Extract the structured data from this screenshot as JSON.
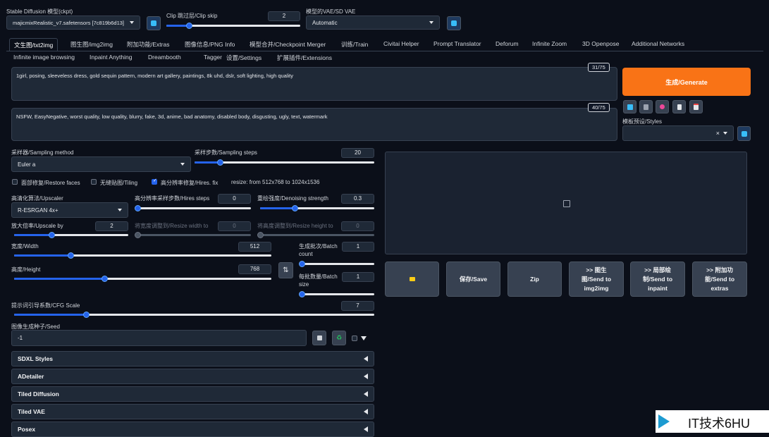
{
  "top": {
    "checkpoint_label": "Stable Diffusion 模型(ckpt)",
    "checkpoint_value": "majicmixRealistic_v7.safetensors [7c819b6d13]",
    "clip_label": "Clip 跳过层/Clip skip",
    "clip_value": "2",
    "clip_fraction": 0.17,
    "vae_label": "模型的VAE/SD VAE",
    "vae_value": "Automatic"
  },
  "tabs_row1": [
    "文生图/txt2img",
    "图生图/img2img",
    "附加功能/Extras",
    "图像信息/PNG Info",
    "模型合并/Checkpoint Merger",
    "训练/Train",
    "Civitai Helper",
    "Prompt Translator",
    "Deforum",
    "Infinite Zoom",
    "3D Openpose",
    "Additional Networks"
  ],
  "tabs_row2": [
    "Infinite image browsing",
    "Inpaint Anything",
    "Dreambooth",
    "Tagger",
    "设置/Settings",
    "扩展插件/Extensions"
  ],
  "prompt": {
    "positive": "1girl, posing, sleeveless dress, gold sequin pattern, modern art gallery, paintings, 8k uhd, dslr, soft lighting, high quality",
    "positive_count": "31/75",
    "negative": "NSFW, EasyNegative, worst quality, low quality, blurry, fake, 3d, anime, bad anatomy, disabled body, disgusting, ugly, text, watermark",
    "negative_count": "40/75"
  },
  "generate_label": "生成/Generate",
  "styles_label": "模板预设/Styles",
  "sampling": {
    "method_label": "采样器/Sampling method",
    "method_value": "Euler a",
    "steps_label": "采样步数/Sampling steps",
    "steps_value": "20",
    "steps_fraction": 0.14
  },
  "checks": {
    "restore_faces": "面部修复/Restore faces",
    "tiling": "无缝贴图/Tiling",
    "hires_fix": "高分辨率修复/Hires. fix",
    "resize_info": "resize: from 512x768 to 1024x1536"
  },
  "hires": {
    "upscaler_label": "高清化算法/Upscaler",
    "upscaler_value": "R-ESRGAN 4x+",
    "steps_label": "高分辨率采样步数/Hires steps",
    "steps_value": "0",
    "steps_fraction": 0.0,
    "denoise_label": "重绘强度/Denoising strength",
    "denoise_value": "0.3",
    "denoise_fraction": 0.3,
    "upscale_label": "放大倍率/Upscale by",
    "upscale_value": "2",
    "upscale_fraction": 0.33,
    "resize_w_label": "将宽度调整到/Resize width to",
    "resize_w_value": "0",
    "resize_h_label": "将高度调整到/Resize height to",
    "resize_h_value": "0"
  },
  "size": {
    "width_label": "宽度/Width",
    "width_value": "512",
    "width_fraction": 0.22,
    "height_label": "高度/Height",
    "height_value": "768",
    "height_fraction": 0.35,
    "batch_count_label": "生成批次/Batch count",
    "batch_count_value": "1",
    "batch_size_label": "每批数量/Batch size",
    "batch_size_value": "1"
  },
  "cfg": {
    "label": "提示词引导系数/CFG Scale",
    "value": "7",
    "fraction": 0.2
  },
  "seed": {
    "label": "图像生成种子/Seed",
    "value": "-1"
  },
  "accordions": [
    "SDXL Styles",
    "ADetailer",
    "Tiled Diffusion",
    "Tiled VAE",
    "Posex"
  ],
  "output_buttons": {
    "save": "保存/Save",
    "zip": "Zip",
    "send_img2img": ">> 图生图/Send to img2img",
    "send_inpaint": ">> 局部绘制/Send to inpaint",
    "send_extras": ">> 附加功能/Send to extras"
  },
  "watermark": "IT技术6HU",
  "colors": {
    "accent": "#2563eb",
    "generate": "#f97316",
    "background": "#0b0f19"
  }
}
